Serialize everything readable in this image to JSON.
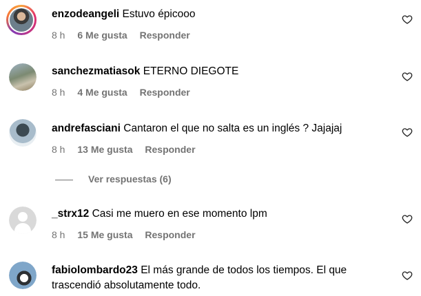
{
  "comments": [
    {
      "username": "enzodeangeli",
      "text": "Estuvo épicooo",
      "time": "8 h",
      "likes": "6 Me gusta",
      "reply": "Responder",
      "avatar": "story"
    },
    {
      "username": "sanchezmatiasok",
      "text": "ETERNO DIEGOTE",
      "time": "8 h",
      "likes": "4 Me gusta",
      "reply": "Responder",
      "avatar": "field"
    },
    {
      "username": "andrefasciani",
      "text": "Cantaron el que no salta es un inglés ? Jajajaj",
      "time": "8 h",
      "likes": "13 Me gusta",
      "reply": "Responder",
      "avatar": "person"
    },
    {
      "username": "_strx12",
      "text": "Casi me muero en ese momento lpm",
      "time": "8 h",
      "likes": "15 Me gusta",
      "reply": "Responder",
      "avatar": "default"
    },
    {
      "username": "fabiolombardo23",
      "text": "El más grande de todos los tiempos. El que trascendió absolutamente todo.",
      "avatar": "sky"
    }
  ],
  "view_replies": "Ver respuestas (6)",
  "icons": {
    "like": "heart-icon",
    "default_avatar": "default-user-icon"
  }
}
